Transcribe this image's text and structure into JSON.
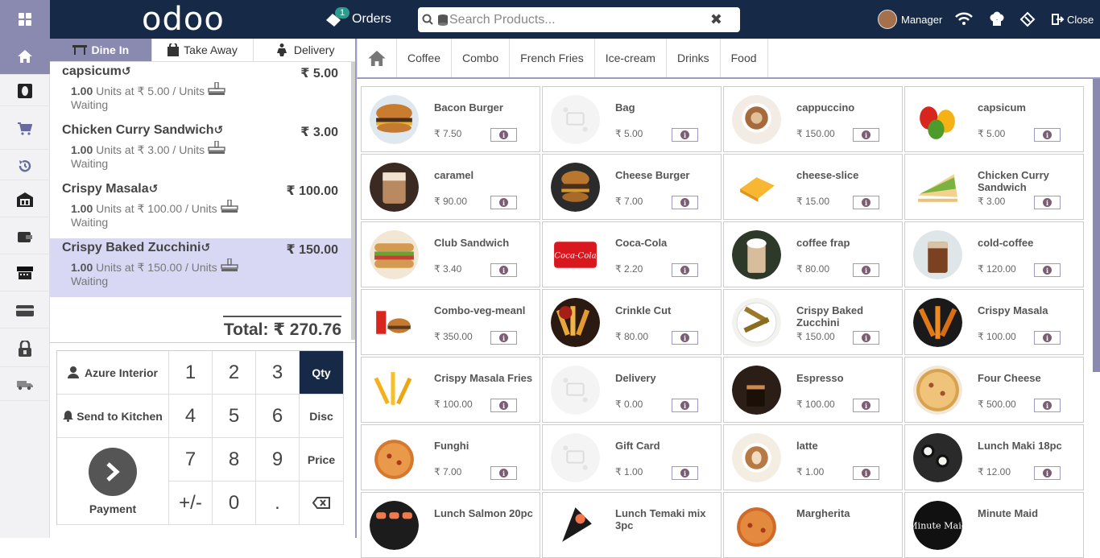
{
  "header": {
    "logo_text": "odoo",
    "orders_label": "Orders",
    "orders_count": "1",
    "search_placeholder": "Search Products...",
    "user_name": "Manager",
    "close_label": "Close"
  },
  "order_tabs": [
    {
      "label": "Dine In",
      "active": true
    },
    {
      "label": "Take Away",
      "active": false
    },
    {
      "label": "Delivery",
      "active": false
    }
  ],
  "orderlines": [
    {
      "name": "capsicum",
      "price": "₹ 5.00",
      "qty": "1.00",
      "unit_text": "Units at ₹ 5.00 / Units",
      "status": "Waiting",
      "selected": false
    },
    {
      "name": "Chicken Curry Sandwich",
      "price": "₹ 3.00",
      "qty": "1.00",
      "unit_text": "Units at ₹ 3.00 / Units",
      "status": "Waiting",
      "selected": false
    },
    {
      "name": "Crispy Masala",
      "price": "₹ 100.00",
      "qty": "1.00",
      "unit_text": "Units at ₹ 100.00 / Units",
      "status": "Waiting",
      "selected": false
    },
    {
      "name": "Crispy Baked Zucchini",
      "price": "₹ 150.00",
      "qty": "1.00",
      "unit_text": "Units at ₹ 150.00 / Units",
      "status": "Waiting",
      "selected": true
    }
  ],
  "total": "Total: ₹ 270.76",
  "pad": {
    "customer": "Azure Interior",
    "send_kitchen": "Send to Kitchen",
    "payment": "Payment",
    "qty": "Qty",
    "disc": "Disc",
    "price": "Price",
    "keys": [
      "1",
      "2",
      "3",
      "4",
      "5",
      "6",
      "7",
      "8",
      "9",
      "+/-",
      "0",
      "."
    ]
  },
  "categories": [
    "Coffee",
    "Combo",
    "French Fries",
    "Ice-cream",
    "Drinks",
    "Food"
  ],
  "products": [
    {
      "name": "Bacon Burger",
      "price": "₹ 7.50",
      "img": "burger"
    },
    {
      "name": "Bag",
      "price": "₹ 5.00",
      "img": "placeholder"
    },
    {
      "name": "cappuccino",
      "price": "₹ 150.00",
      "img": "cup"
    },
    {
      "name": "capsicum",
      "price": "₹ 5.00",
      "img": "pepper"
    },
    {
      "name": "caramel",
      "price": "₹ 90.00",
      "img": "glass"
    },
    {
      "name": "Cheese Burger",
      "price": "₹ 7.00",
      "img": "burger2"
    },
    {
      "name": "cheese-slice",
      "price": "₹ 15.00",
      "img": "cheese"
    },
    {
      "name": "Chicken Curry Sandwich",
      "price": "₹ 3.00",
      "img": "sandwich"
    },
    {
      "name": "Club Sandwich",
      "price": "₹ 3.40",
      "img": "club"
    },
    {
      "name": "Coca-Cola",
      "price": "₹ 2.20",
      "img": "coke"
    },
    {
      "name": "coffee frap",
      "price": "₹ 80.00",
      "img": "frap"
    },
    {
      "name": "cold-coffee",
      "price": "₹ 120.00",
      "img": "cold"
    },
    {
      "name": "Combo-veg-meanl",
      "price": "₹ 350.00",
      "img": "combo"
    },
    {
      "name": "Crinkle Cut",
      "price": "₹ 80.00",
      "img": "fries"
    },
    {
      "name": "Crispy Baked Zucchini",
      "price": "₹ 150.00",
      "img": "zucchini"
    },
    {
      "name": "Crispy Masala",
      "price": "₹ 100.00",
      "img": "fries2"
    },
    {
      "name": "Crispy Masala Fries",
      "price": "₹ 100.00",
      "img": "fries3"
    },
    {
      "name": "Delivery",
      "price": "₹ 0.00",
      "img": "placeholder"
    },
    {
      "name": "Espresso",
      "price": "₹ 100.00",
      "img": "espresso"
    },
    {
      "name": "Four Cheese",
      "price": "₹ 500.00",
      "img": "pizza"
    },
    {
      "name": "Funghi",
      "price": "₹ 7.00",
      "img": "pizza2"
    },
    {
      "name": "Gift Card",
      "price": "₹ 1.00",
      "img": "placeholder"
    },
    {
      "name": "latte",
      "price": "₹ 1.00",
      "img": "latte"
    },
    {
      "name": "Lunch Maki 18pc",
      "price": "₹ 12.00",
      "img": "maki"
    },
    {
      "name": "Lunch Salmon 20pc",
      "price": "",
      "img": "sushi"
    },
    {
      "name": "Lunch Temaki mix 3pc",
      "price": "",
      "img": "temaki"
    },
    {
      "name": "Margherita",
      "price": "",
      "img": "pizza3"
    },
    {
      "name": "Minute Maid",
      "price": "",
      "img": "minutemaid"
    }
  ],
  "image_text": {
    "coke": "Coca-Cola",
    "minutemaid": "Minute Maid"
  },
  "colors": {
    "topbar": "#162a47",
    "accent": "#8a89b0",
    "selected_line": "#d8d8f5"
  }
}
